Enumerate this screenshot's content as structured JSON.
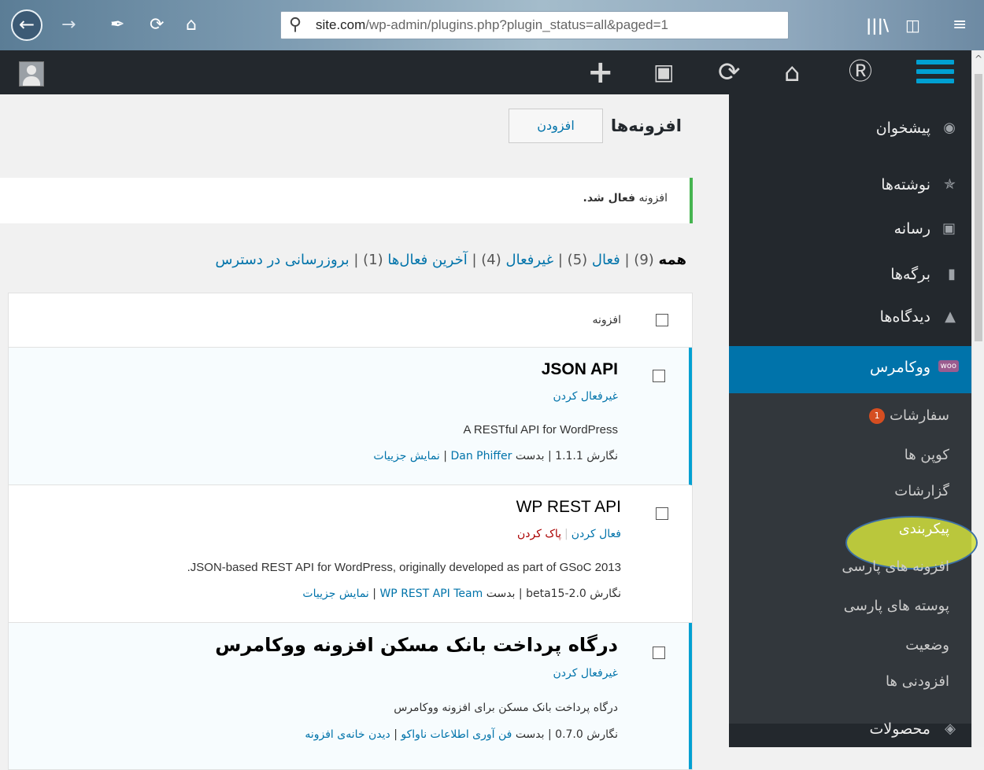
{
  "browser": {
    "url_host": "site.com",
    "url_path": "/wp-admin/plugins.php?plugin_status=all&paged=1",
    "icons": [
      "back-icon",
      "forward-icon",
      "wrench-icon",
      "reload-icon",
      "home-icon",
      "search-icon",
      "library-icon",
      "sidebar-icon",
      "menu-icon"
    ]
  },
  "admin_bar": {
    "icons": [
      "hamburger-menu-icon",
      "wordpress-logo-icon",
      "home-icon",
      "updates-icon",
      "comments-icon",
      "new-content-icon",
      "avatar"
    ]
  },
  "sidebar": {
    "items": [
      {
        "label": "پیشخوان",
        "icon": "dashboard-icon"
      },
      {
        "label": "نوشته‌ها",
        "icon": "pin-icon"
      },
      {
        "label": "رسانه",
        "icon": "media-icon"
      },
      {
        "label": "برگه‌ها",
        "icon": "pages-icon"
      },
      {
        "label": "دیدگاه‌ها",
        "icon": "comments-icon"
      }
    ],
    "woo": {
      "label": "ووکامرس",
      "icon_text": "woo"
    },
    "submenu": [
      {
        "label": "سفارشات",
        "badge": "1"
      },
      {
        "label": "کوپن ها"
      },
      {
        "label": "گزارشات"
      },
      {
        "label": "پیکربندی"
      },
      {
        "label": "افزونه های پارسی"
      },
      {
        "label": "پوسته های پارسی"
      },
      {
        "label": "وضعیت"
      },
      {
        "label": "افزودنی ها"
      }
    ],
    "products": {
      "label": "محصولات",
      "icon": "products-icon"
    }
  },
  "main": {
    "title": "افزونه‌ها",
    "add_button": "افزودن",
    "notice": {
      "prefix": "افزونه",
      "bold": "فعال شد."
    },
    "filters": {
      "all_label": "همه",
      "all_count": "(9)",
      "active_label": "فعال",
      "active_count": "(5)",
      "inactive_label": "غیرفعال",
      "inactive_count": "(4)",
      "recent_label": "آخرین فعال‌ها",
      "recent_count": "(1)",
      "update_label": "بروزرسانی در دسترس"
    },
    "table_header": "افزونه",
    "plugins": [
      {
        "name": "JSON API",
        "actions": [
          "غیرفعال کردن"
        ],
        "description": "A RESTful API for WordPress",
        "version_label": "نگارش",
        "version": "1.1.1",
        "by_label": "بدست",
        "author": "Dan Phiffer",
        "details": "نمایش جزییات"
      },
      {
        "name": "WP REST API",
        "actions": [
          "فعال کردن",
          "پاک کردن"
        ],
        "description": "JSON-based REST API for WordPress, originally developed as part of GSoC 2013.",
        "version_label": "نگارش",
        "version": "2.0-beta15",
        "by_label": "بدست",
        "author": "WP REST API Team",
        "details": "نمایش جزییات"
      },
      {
        "name": "درگاه پرداخت بانک مسکن افزونه ووکامرس",
        "actions": [
          "غیرفعال کردن"
        ],
        "description": "درگاه پرداخت بانک مسکن برای افزونه ووکامرس",
        "version_label": "نگارش",
        "version": "0.7.0",
        "by_label": "بدست",
        "author": "فن آوری اطلاعات ناواکو",
        "details": "دیدن خانه‌ی افزونه"
      }
    ]
  }
}
